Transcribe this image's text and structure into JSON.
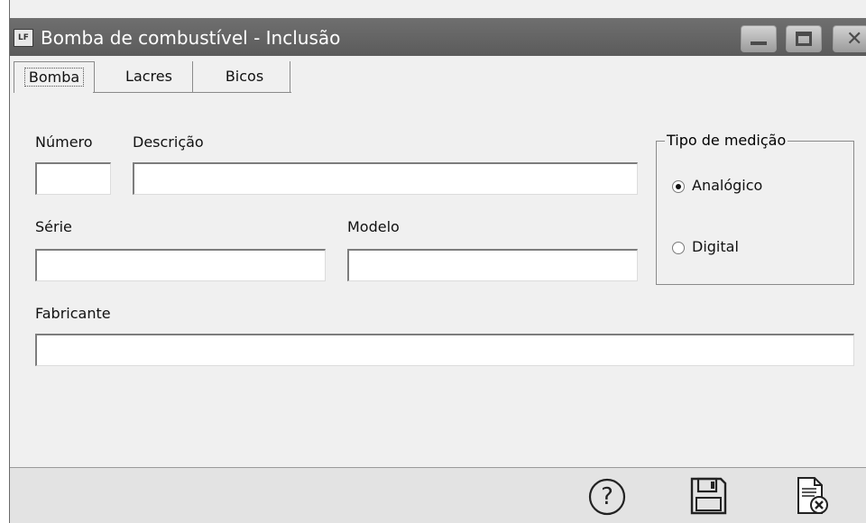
{
  "window": {
    "app_icon_text": "LF",
    "title": "Bomba de combustível - Inclusão"
  },
  "tabs": [
    {
      "label": "Bomba",
      "active": true
    },
    {
      "label": "Lacres",
      "active": false
    },
    {
      "label": "Bicos",
      "active": false
    }
  ],
  "form": {
    "numero_label": "Número",
    "numero_value": "",
    "descricao_label": "Descrição",
    "descricao_value": "",
    "serie_label": "Série",
    "serie_value": "",
    "modelo_label": "Modelo",
    "modelo_value": "",
    "fabricante_label": "Fabricante",
    "fabricante_value": ""
  },
  "tipo_medicao": {
    "title": "Tipo de medição",
    "options": [
      {
        "label": "Analógico",
        "checked": true
      },
      {
        "label": "Digital",
        "checked": false
      }
    ]
  },
  "toolbar": {
    "icons": [
      "help-icon",
      "save-icon",
      "cancel-document-icon"
    ]
  }
}
